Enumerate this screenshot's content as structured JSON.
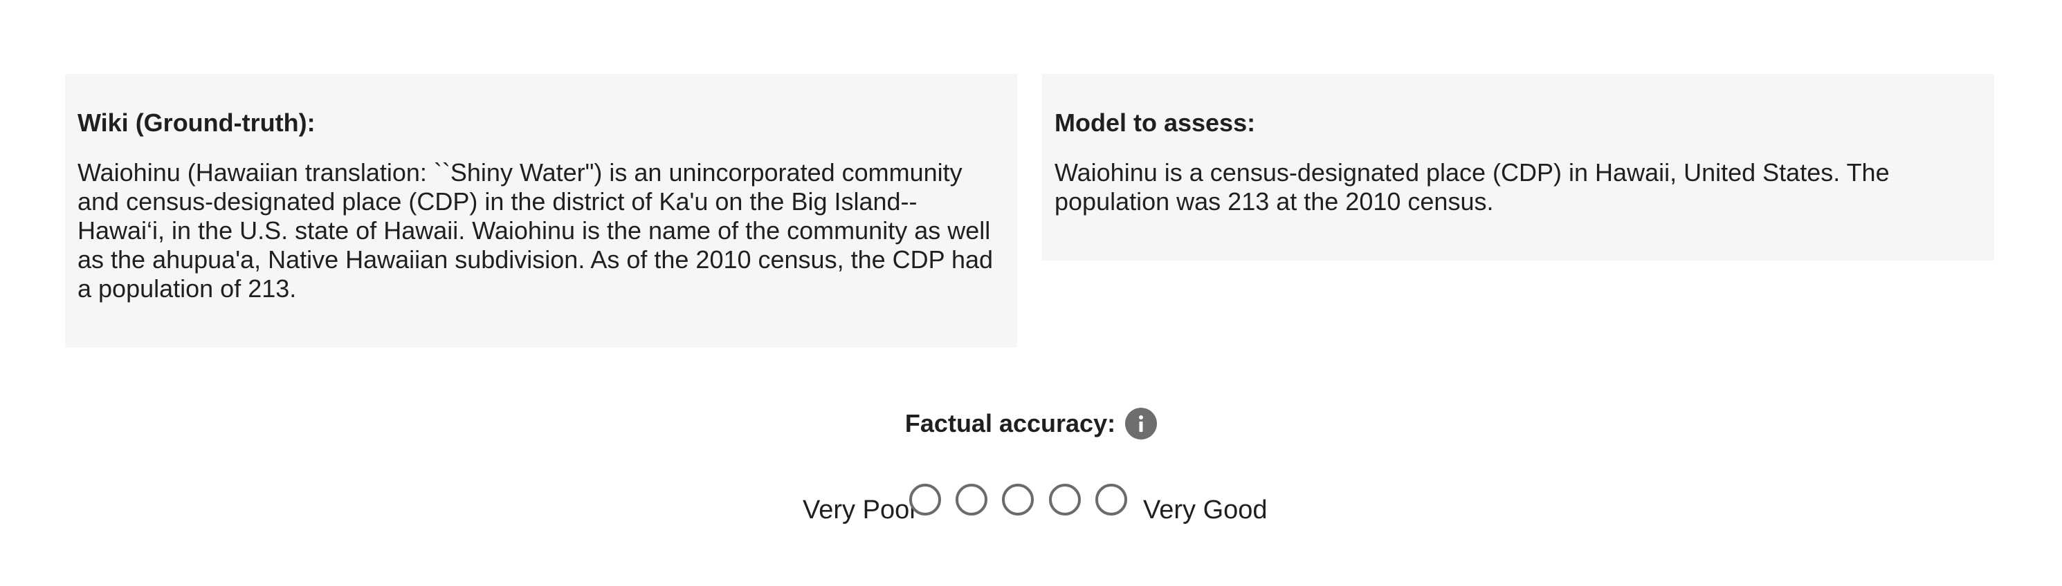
{
  "reference_panel": {
    "title": "Wiki (Ground-truth):",
    "text": "Waiohinu (Hawaiian translation: ``Shiny Water\") is an unincorporated community and census-designated place (CDP) in the district of Ka'u on the Big Island-- Hawai‘i, in the U.S. state of Hawaii. Waiohinu is the name of the community as well as the ahupua'a, Native Hawaiian subdivision. As of the 2010 census, the CDP had a population of 213."
  },
  "model_panel": {
    "title": "Model to assess:",
    "text": "Waiohinu is a census-designated place (CDP) in Hawaii, United States. The population was 213 at the 2010 census."
  },
  "rating": {
    "title": "Factual accuracy:",
    "info_icon": "info-icon",
    "low_label": "Very Poor",
    "high_label": "Very Good",
    "options_count": 5,
    "selected": null
  },
  "colors": {
    "panel_background": "#f6f6f6",
    "icon_background": "#6e6e6e",
    "radio_border": "#6b6b6b"
  }
}
